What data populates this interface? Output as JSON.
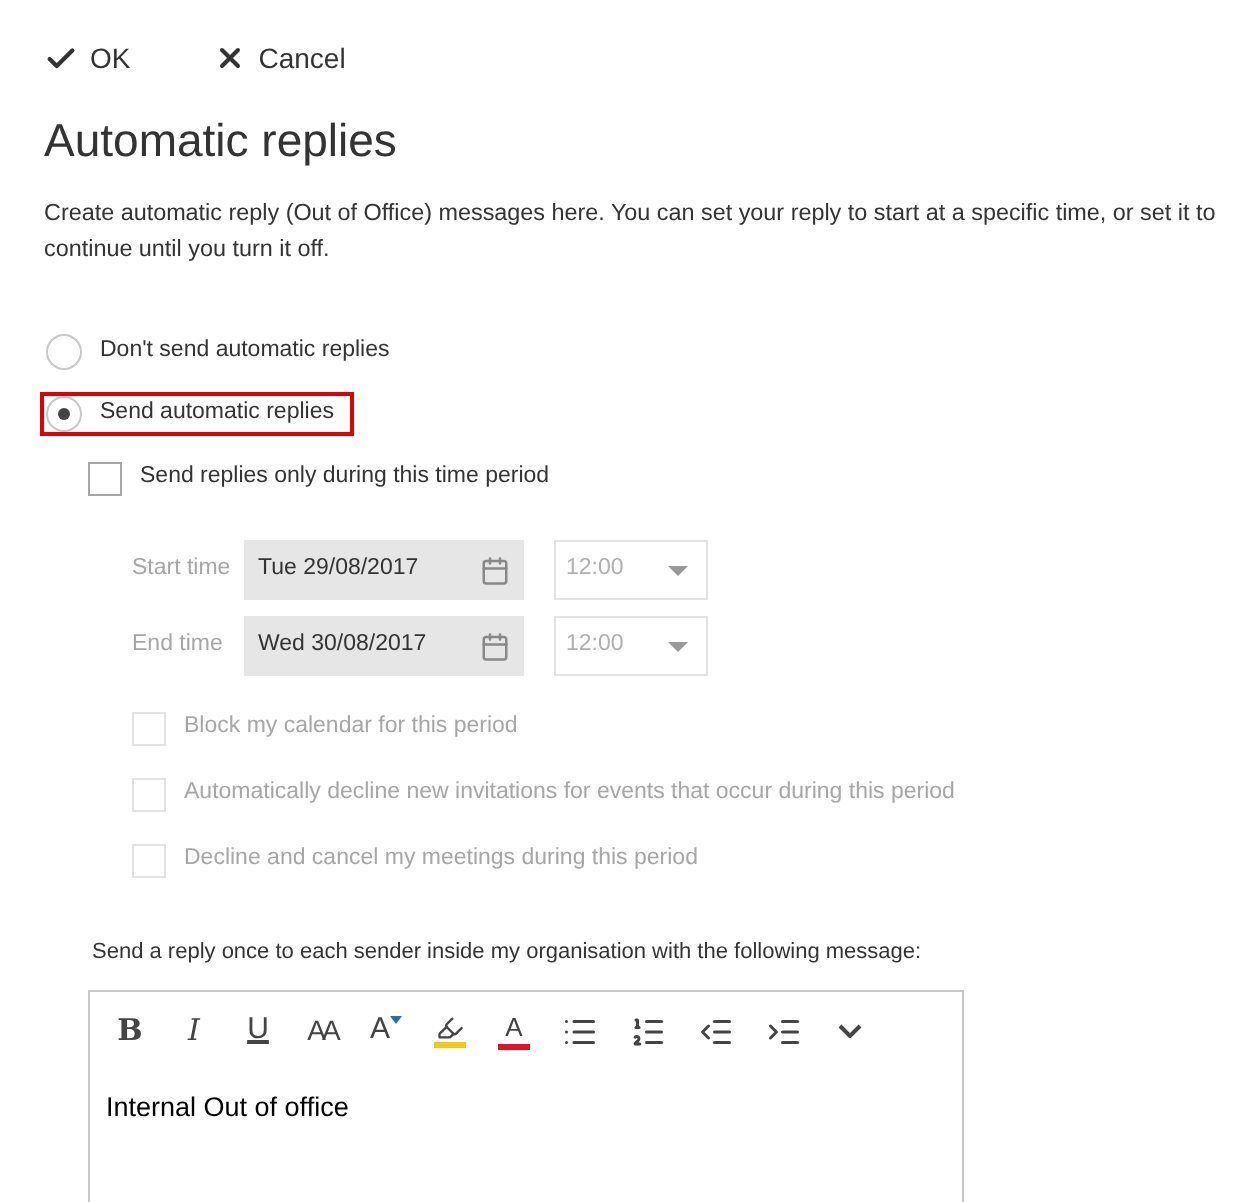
{
  "actions": [
    {
      "kind": "ok",
      "label": "OK"
    },
    {
      "kind": "cancel",
      "label": "Cancel"
    }
  ],
  "title": "Automatic replies",
  "description": "Create automatic reply (Out of Office) messages here. You can set your reply to start at a specific time, or set it to continue until you turn it off.",
  "reply_options": [
    {
      "label": "Don't send automatic replies",
      "selected": false,
      "highlighted": false
    },
    {
      "label": "Send automatic replies",
      "selected": true,
      "highlighted": true
    }
  ],
  "time_period": {
    "label": "Send replies only during this time period",
    "checked": false
  },
  "times": [
    {
      "label": "Start time",
      "date": "Tue 29/08/2017",
      "time": "12:00",
      "disabled": true
    },
    {
      "label": "End time",
      "date": "Wed 30/08/2017",
      "time": "12:00",
      "disabled": true
    }
  ],
  "period_options": [
    {
      "label": "Block my calendar for this period",
      "checked": false,
      "disabled": true
    },
    {
      "label": "Automatically decline new invitations for events that occur during this period",
      "checked": false,
      "disabled": true
    },
    {
      "label": "Decline and cancel my meetings during this period",
      "checked": false,
      "disabled": true
    }
  ],
  "message_label": "Send a reply once to each sender inside my organisation with the following message:",
  "toolbar": [
    {
      "kind": "bold",
      "label": "B"
    },
    {
      "kind": "italic",
      "label": "I"
    },
    {
      "kind": "underline",
      "label": "U"
    },
    {
      "kind": "font-size",
      "label": "AA"
    },
    {
      "kind": "grow",
      "label": "A"
    },
    {
      "kind": "highlight"
    },
    {
      "kind": "font-color",
      "label": "A"
    },
    {
      "kind": "bullets"
    },
    {
      "kind": "numbering"
    },
    {
      "kind": "outdent"
    },
    {
      "kind": "indent"
    },
    {
      "kind": "more"
    }
  ],
  "message": "Internal Out of office"
}
